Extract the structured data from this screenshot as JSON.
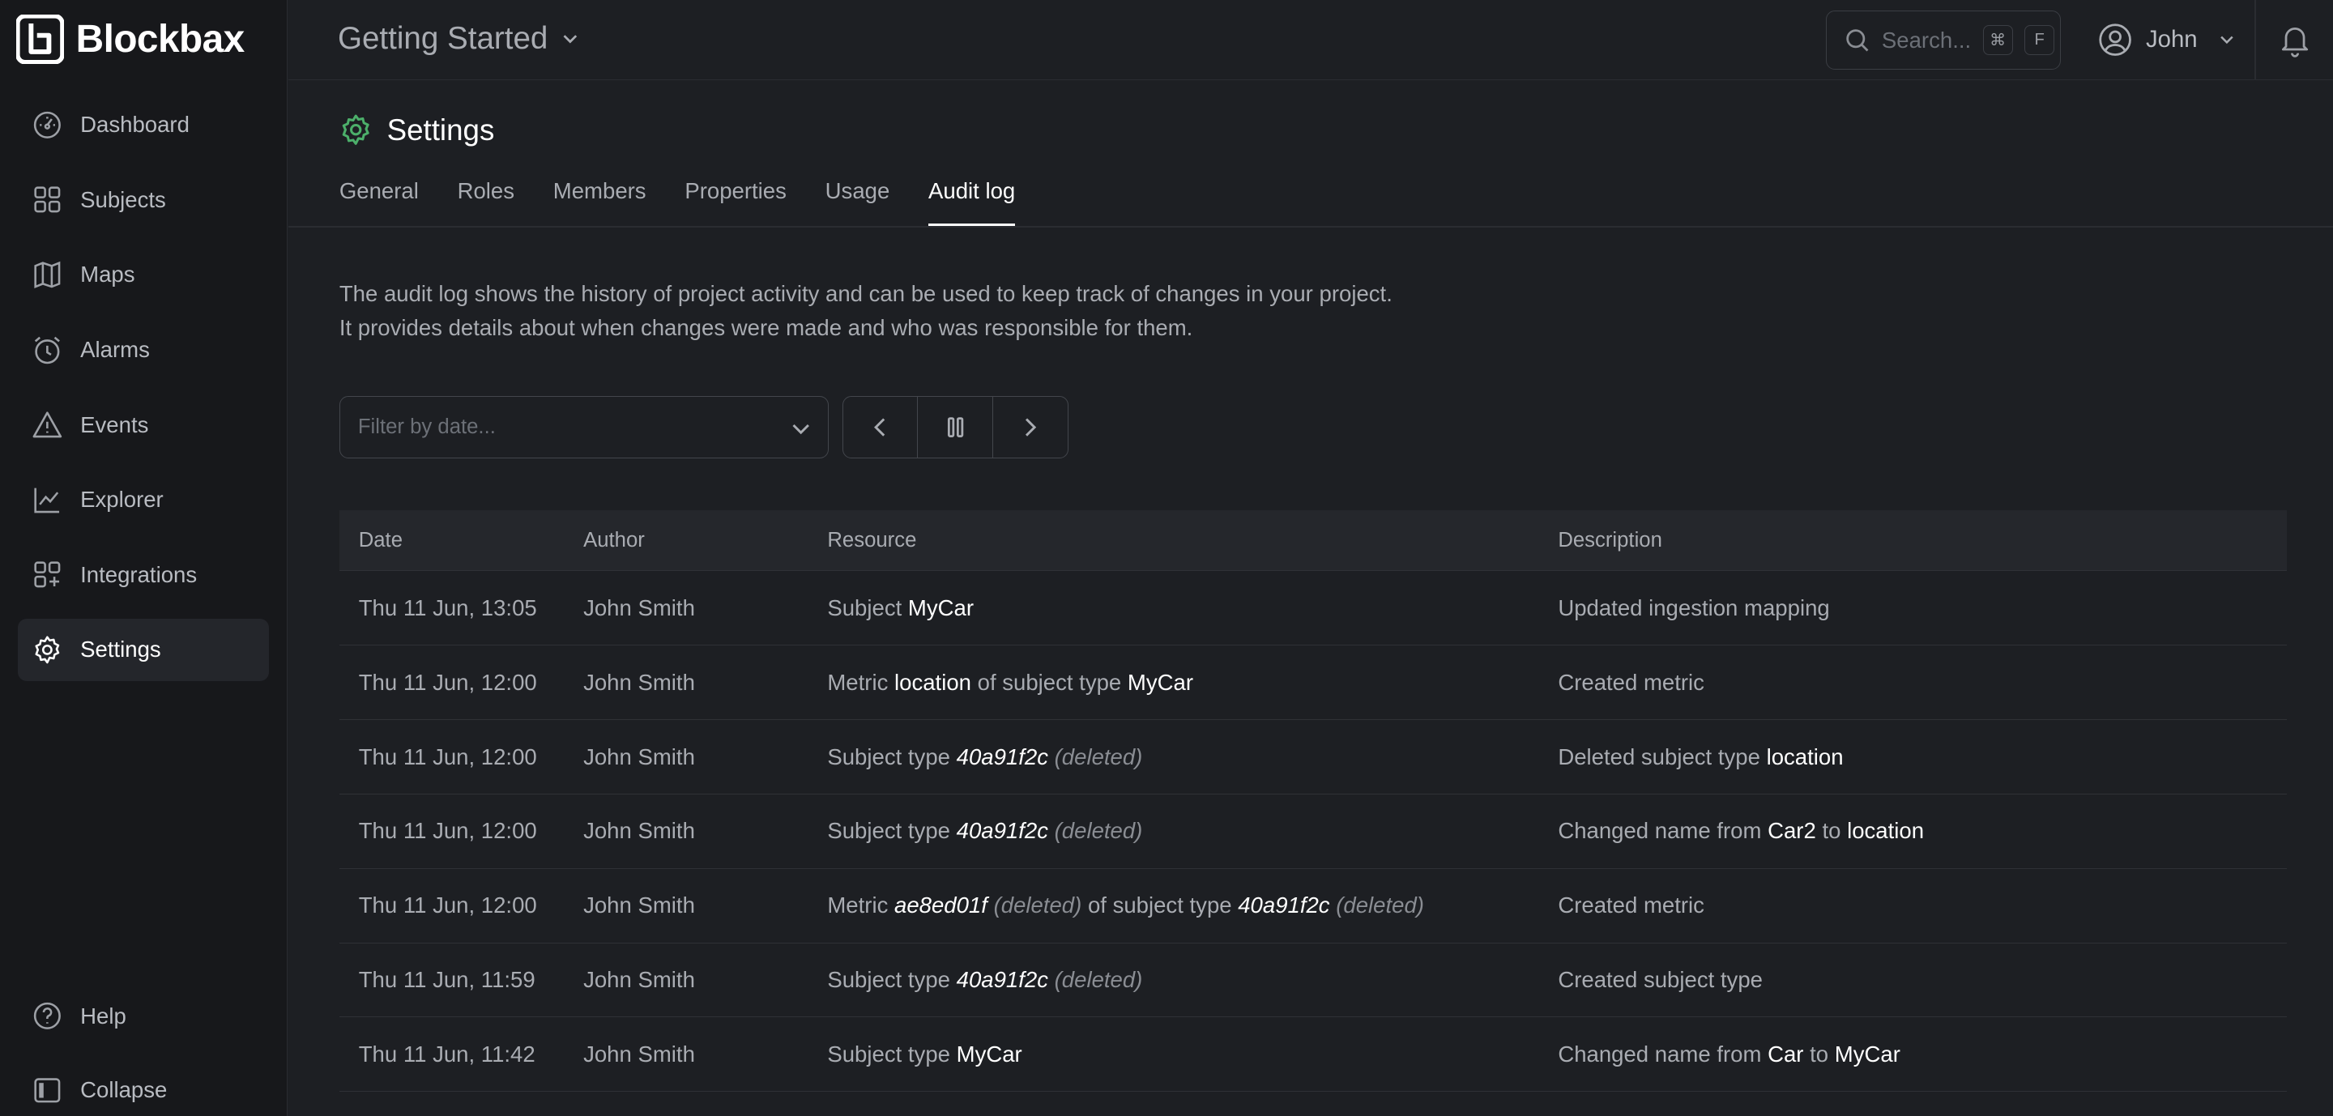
{
  "brand": {
    "name": "Blockbax"
  },
  "sidebar": {
    "items": [
      {
        "label": "Dashboard",
        "icon": "dashboard-gauge-icon"
      },
      {
        "label": "Subjects",
        "icon": "grid-icon"
      },
      {
        "label": "Maps",
        "icon": "map-icon"
      },
      {
        "label": "Alarms",
        "icon": "alarm-clock-icon"
      },
      {
        "label": "Events",
        "icon": "warning-triangle-icon"
      },
      {
        "label": "Explorer",
        "icon": "line-chart-icon"
      },
      {
        "label": "Integrations",
        "icon": "integrations-grid-plus-icon"
      },
      {
        "label": "Settings",
        "icon": "gear-icon",
        "active": true
      }
    ],
    "bottom": [
      {
        "label": "Help",
        "icon": "help-circle-icon"
      },
      {
        "label": "Collapse",
        "icon": "collapse-panel-icon"
      }
    ]
  },
  "topbar": {
    "project": "Getting Started",
    "search_placeholder": "Search...",
    "shortcut_key1": "⌘",
    "shortcut_key2": "F",
    "user": "John"
  },
  "page": {
    "title": "Settings",
    "tabs": [
      "General",
      "Roles",
      "Members",
      "Properties",
      "Usage",
      "Audit log"
    ],
    "active_tab": "Audit log",
    "intro": "The audit log shows the history of project activity and can be used to keep track of changes in your project. It provides details about when changes were made and who was responsible for them.",
    "filter_placeholder": "Filter by date..."
  },
  "table": {
    "headers": [
      "Date",
      "Author",
      "Resource",
      "Description"
    ],
    "rows": [
      {
        "date": "Thu 11 Jun, 13:05",
        "author": "John Smith",
        "resource": [
          [
            "Subject ",
            "n"
          ],
          [
            "MyCar",
            "h"
          ]
        ],
        "description": [
          [
            "Updated ingestion mapping",
            "n"
          ]
        ]
      },
      {
        "date": "Thu 11 Jun, 12:00",
        "author": "John Smith",
        "resource": [
          [
            "Metric ",
            "n"
          ],
          [
            "location",
            "h"
          ],
          [
            " of subject type ",
            "n"
          ],
          [
            "MyCar",
            "h"
          ]
        ],
        "description": [
          [
            "Created metric",
            "n"
          ]
        ]
      },
      {
        "date": "Thu 11 Jun, 12:00",
        "author": "John Smith",
        "resource": [
          [
            "Subject type ",
            "n"
          ],
          [
            "40a91f2c",
            "i"
          ],
          [
            " (deleted)",
            "d"
          ]
        ],
        "description": [
          [
            "Deleted subject type ",
            "n"
          ],
          [
            "location",
            "h"
          ]
        ]
      },
      {
        "date": "Thu 11 Jun, 12:00",
        "author": "John Smith",
        "resource": [
          [
            "Subject type ",
            "n"
          ],
          [
            "40a91f2c",
            "i"
          ],
          [
            " (deleted)",
            "d"
          ]
        ],
        "description": [
          [
            "Changed name from ",
            "n"
          ],
          [
            "Car2",
            "h"
          ],
          [
            " to ",
            "n"
          ],
          [
            "location",
            "h"
          ]
        ]
      },
      {
        "date": "Thu 11 Jun, 12:00",
        "author": "John Smith",
        "resource": [
          [
            "Metric ",
            "n"
          ],
          [
            "ae8ed01f",
            "i"
          ],
          [
            " (deleted)",
            "d"
          ],
          [
            " of subject type ",
            "n"
          ],
          [
            "40a91f2c",
            "i"
          ],
          [
            " (deleted)",
            "d"
          ]
        ],
        "description": [
          [
            "Created metric",
            "n"
          ]
        ]
      },
      {
        "date": "Thu 11 Jun, 11:59",
        "author": "John Smith",
        "resource": [
          [
            "Subject type ",
            "n"
          ],
          [
            "40a91f2c",
            "i"
          ],
          [
            " (deleted)",
            "d"
          ]
        ],
        "description": [
          [
            "Created subject type",
            "n"
          ]
        ]
      },
      {
        "date": "Thu 11 Jun, 11:42",
        "author": "John Smith",
        "resource": [
          [
            "Subject type ",
            "n"
          ],
          [
            "MyCar",
            "h"
          ]
        ],
        "description": [
          [
            "Changed name from ",
            "n"
          ],
          [
            "Car",
            "h"
          ],
          [
            " to ",
            "n"
          ],
          [
            "MyCar",
            "h"
          ]
        ]
      }
    ]
  }
}
